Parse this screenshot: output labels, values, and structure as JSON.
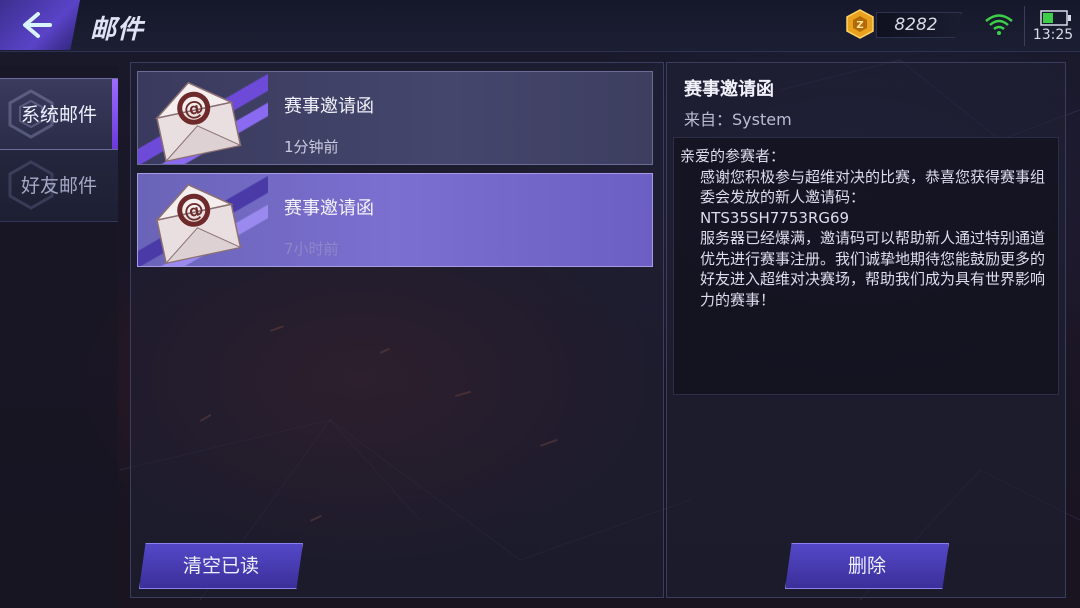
{
  "header": {
    "title": "邮件",
    "coins": "8282",
    "time": "13:25",
    "icons": {
      "back": "back-arrow-icon",
      "coin": "gold-coin-icon",
      "wifi": "wifi-icon",
      "battery": "battery-icon"
    }
  },
  "tabs": [
    {
      "label": "系统邮件",
      "active": true
    },
    {
      "label": "好友邮件",
      "active": false
    }
  ],
  "mails": [
    {
      "subject": "赛事邀请函",
      "time": "1分钟前",
      "selected": false
    },
    {
      "subject": "赛事邀请函",
      "time": "7小时前",
      "selected": true
    }
  ],
  "list_actions": {
    "clear_read": "清空已读"
  },
  "detail": {
    "title": "赛事邀请函",
    "from_label": "来自：",
    "from": "System",
    "body": [
      "亲爱的参赛者：",
      "感谢您积极参与超维对决的比赛，恭喜您获得赛事组委会发放的新人邀请码：",
      "NTS35SH7753RG69",
      "服务器已经爆满，邀请码可以帮助新人通过特别通道优先进行赛事注册。我们诚挚地期待您能鼓励更多的好友进入超维对决赛场，帮助我们成为具有世界影响力的赛事！"
    ],
    "delete_label": "删除"
  },
  "colors": {
    "accent": "#5548c8",
    "selected_item": "#7b6fd0",
    "background": "#1b1626"
  }
}
